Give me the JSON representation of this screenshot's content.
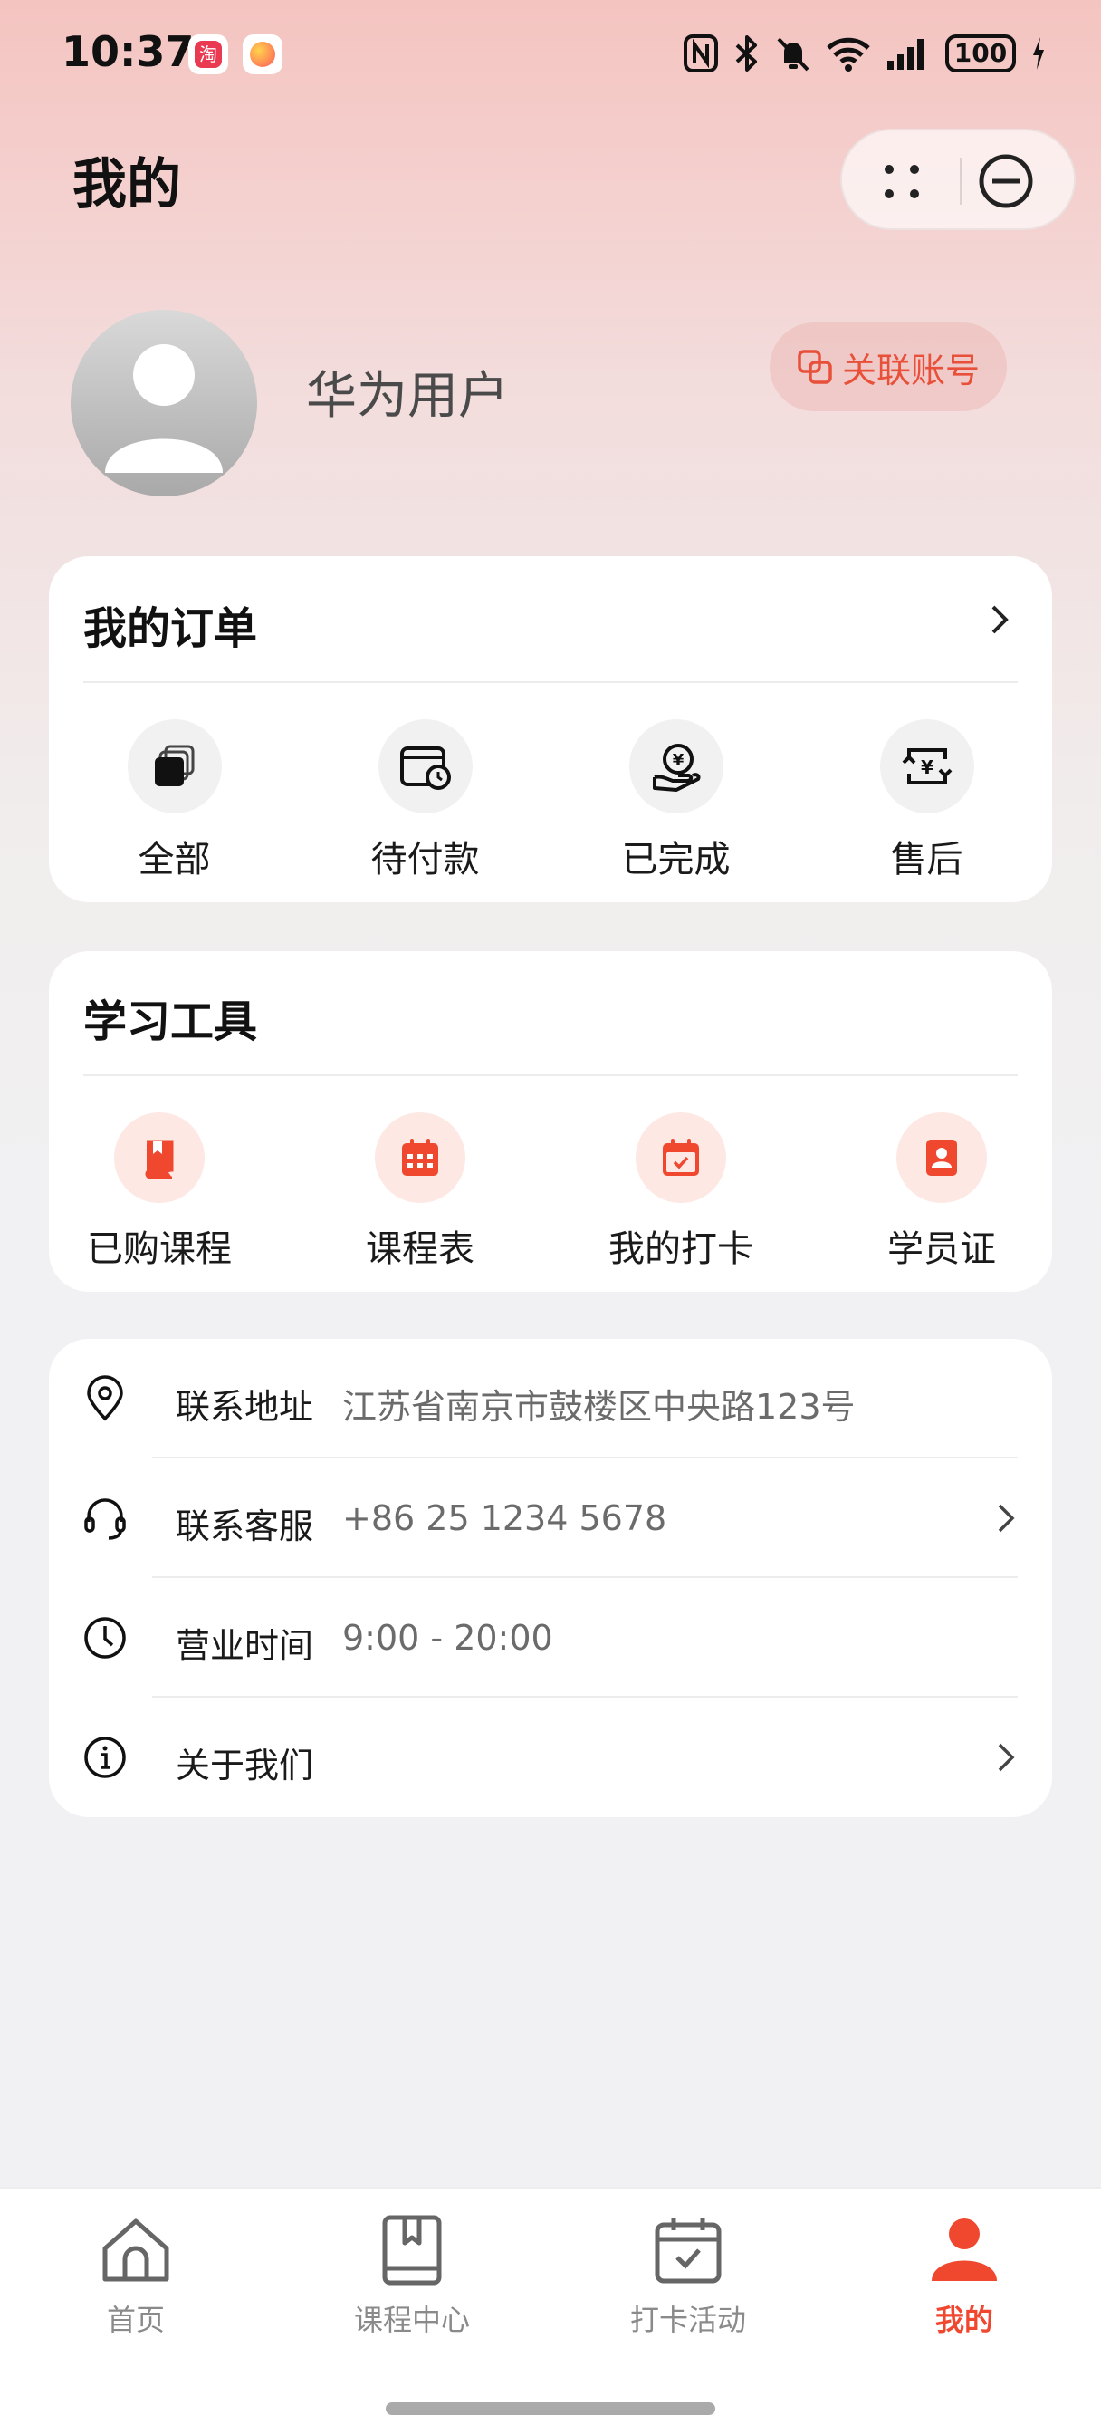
{
  "status_bar": {
    "time": "10:37",
    "battery": "100",
    "notif_icon_1_text": "淘"
  },
  "header": {
    "title": "我的"
  },
  "profile": {
    "user_name": "华为用户",
    "link_account_label": "关联账号"
  },
  "orders": {
    "title": "我的订单",
    "items": [
      {
        "label": "全部",
        "icon": "all-orders-icon"
      },
      {
        "label": "待付款",
        "icon": "wallet-clock-icon"
      },
      {
        "label": "已完成",
        "icon": "hand-coin-icon"
      },
      {
        "label": "售后",
        "icon": "refund-icon"
      }
    ]
  },
  "tools": {
    "title": "学习工具",
    "items": [
      {
        "label": "已购课程",
        "icon": "book-icon"
      },
      {
        "label": "课程表",
        "icon": "calendar-icon"
      },
      {
        "label": "我的打卡",
        "icon": "calendar-check-icon"
      },
      {
        "label": "学员证",
        "icon": "id-card-icon"
      }
    ]
  },
  "info": {
    "address_label": "联系地址",
    "address_value": "江苏省南京市鼓楼区中央路123号",
    "service_label": "联系客服",
    "service_value": "+86 25 1234 5678",
    "hours_label": "营业时间",
    "hours_value": "9:00 - 20:00",
    "about_label": "关于我们"
  },
  "tab_bar": {
    "tabs": [
      {
        "label": "首页",
        "icon": "home-icon",
        "active": false
      },
      {
        "label": "课程中心",
        "icon": "course-book-icon",
        "active": false
      },
      {
        "label": "打卡活动",
        "icon": "calendar-check-icon",
        "active": false
      },
      {
        "label": "我的",
        "icon": "person-icon",
        "active": true
      }
    ]
  },
  "colors": {
    "accent": "#f0472f",
    "accent_light": "#fde8e4",
    "text_secondary": "#6b6b6b"
  }
}
